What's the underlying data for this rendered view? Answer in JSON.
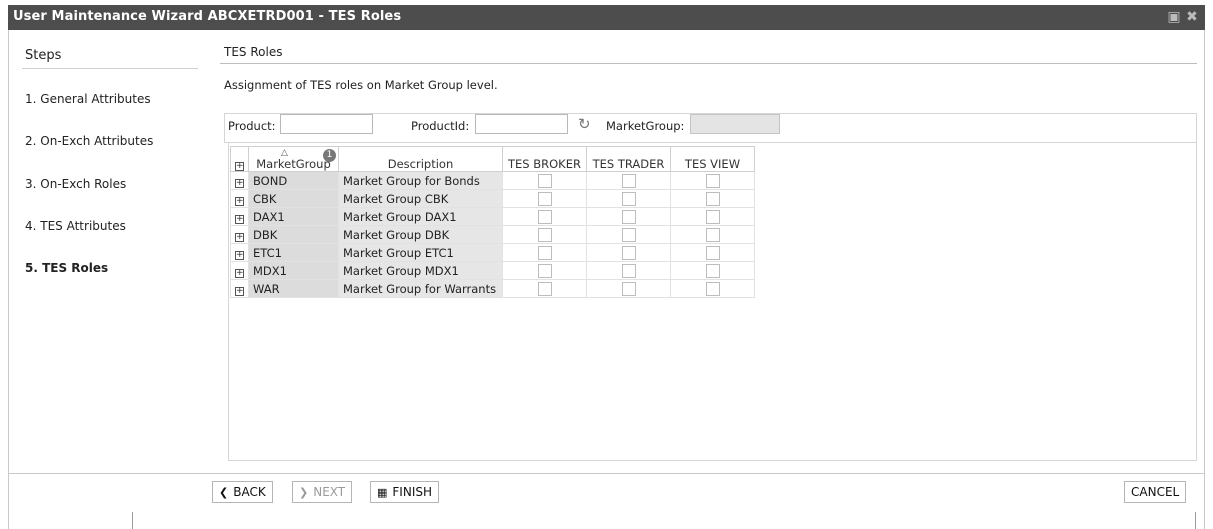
{
  "window": {
    "title": "User Maintenance Wizard ABCXETRD001 - TES Roles",
    "icons": [
      "restore-icon",
      "close-icon"
    ]
  },
  "steps": {
    "heading": "Steps",
    "items": [
      {
        "label": "1. General Attributes"
      },
      {
        "label": "2. On-Exch Attributes"
      },
      {
        "label": "3. On-Exch Roles"
      },
      {
        "label": "4. TES Attributes"
      },
      {
        "label": "5. TES Roles",
        "active": true
      }
    ]
  },
  "main": {
    "title": "TES Roles",
    "description": "Assignment of TES roles on Market Group level."
  },
  "filters": {
    "product_label": "Product:",
    "product_value": "",
    "productid_label": "ProductId:",
    "productid_value": "",
    "marketgroup_label": "MarketGroup:",
    "marketgroup_value": ""
  },
  "grid": {
    "sort_badge": "1",
    "headers": {
      "marketgroup": "MarketGroup",
      "description": "Description",
      "tes_broker": "TES BROKER",
      "tes_trader": "TES TRADER",
      "tes_view": "TES VIEW"
    },
    "rows": [
      {
        "marketgroup": "BOND",
        "description": "Market Group for Bonds",
        "tes_broker": false,
        "tes_trader": false,
        "tes_view": false
      },
      {
        "marketgroup": "CBK",
        "description": "Market Group CBK",
        "tes_broker": false,
        "tes_trader": false,
        "tes_view": false
      },
      {
        "marketgroup": "DAX1",
        "description": "Market Group DAX1",
        "tes_broker": false,
        "tes_trader": false,
        "tes_view": false
      },
      {
        "marketgroup": "DBK",
        "description": "Market Group DBK",
        "tes_broker": false,
        "tes_trader": false,
        "tes_view": false
      },
      {
        "marketgroup": "ETC1",
        "description": "Market Group ETC1",
        "tes_broker": false,
        "tes_trader": false,
        "tes_view": false
      },
      {
        "marketgroup": "MDX1",
        "description": "Market Group MDX1",
        "tes_broker": false,
        "tes_trader": false,
        "tes_view": false
      },
      {
        "marketgroup": "WAR",
        "description": "Market Group for Warrants",
        "tes_broker": false,
        "tes_trader": false,
        "tes_view": false
      }
    ]
  },
  "buttons": {
    "back": "BACK",
    "next": "NEXT",
    "finish": "FINISH",
    "cancel": "CANCEL"
  },
  "colors": {
    "titlebar": "#4d4d4d",
    "marketgroup_cell": "#dcdcdc",
    "description_cell": "#e6e6e6"
  }
}
